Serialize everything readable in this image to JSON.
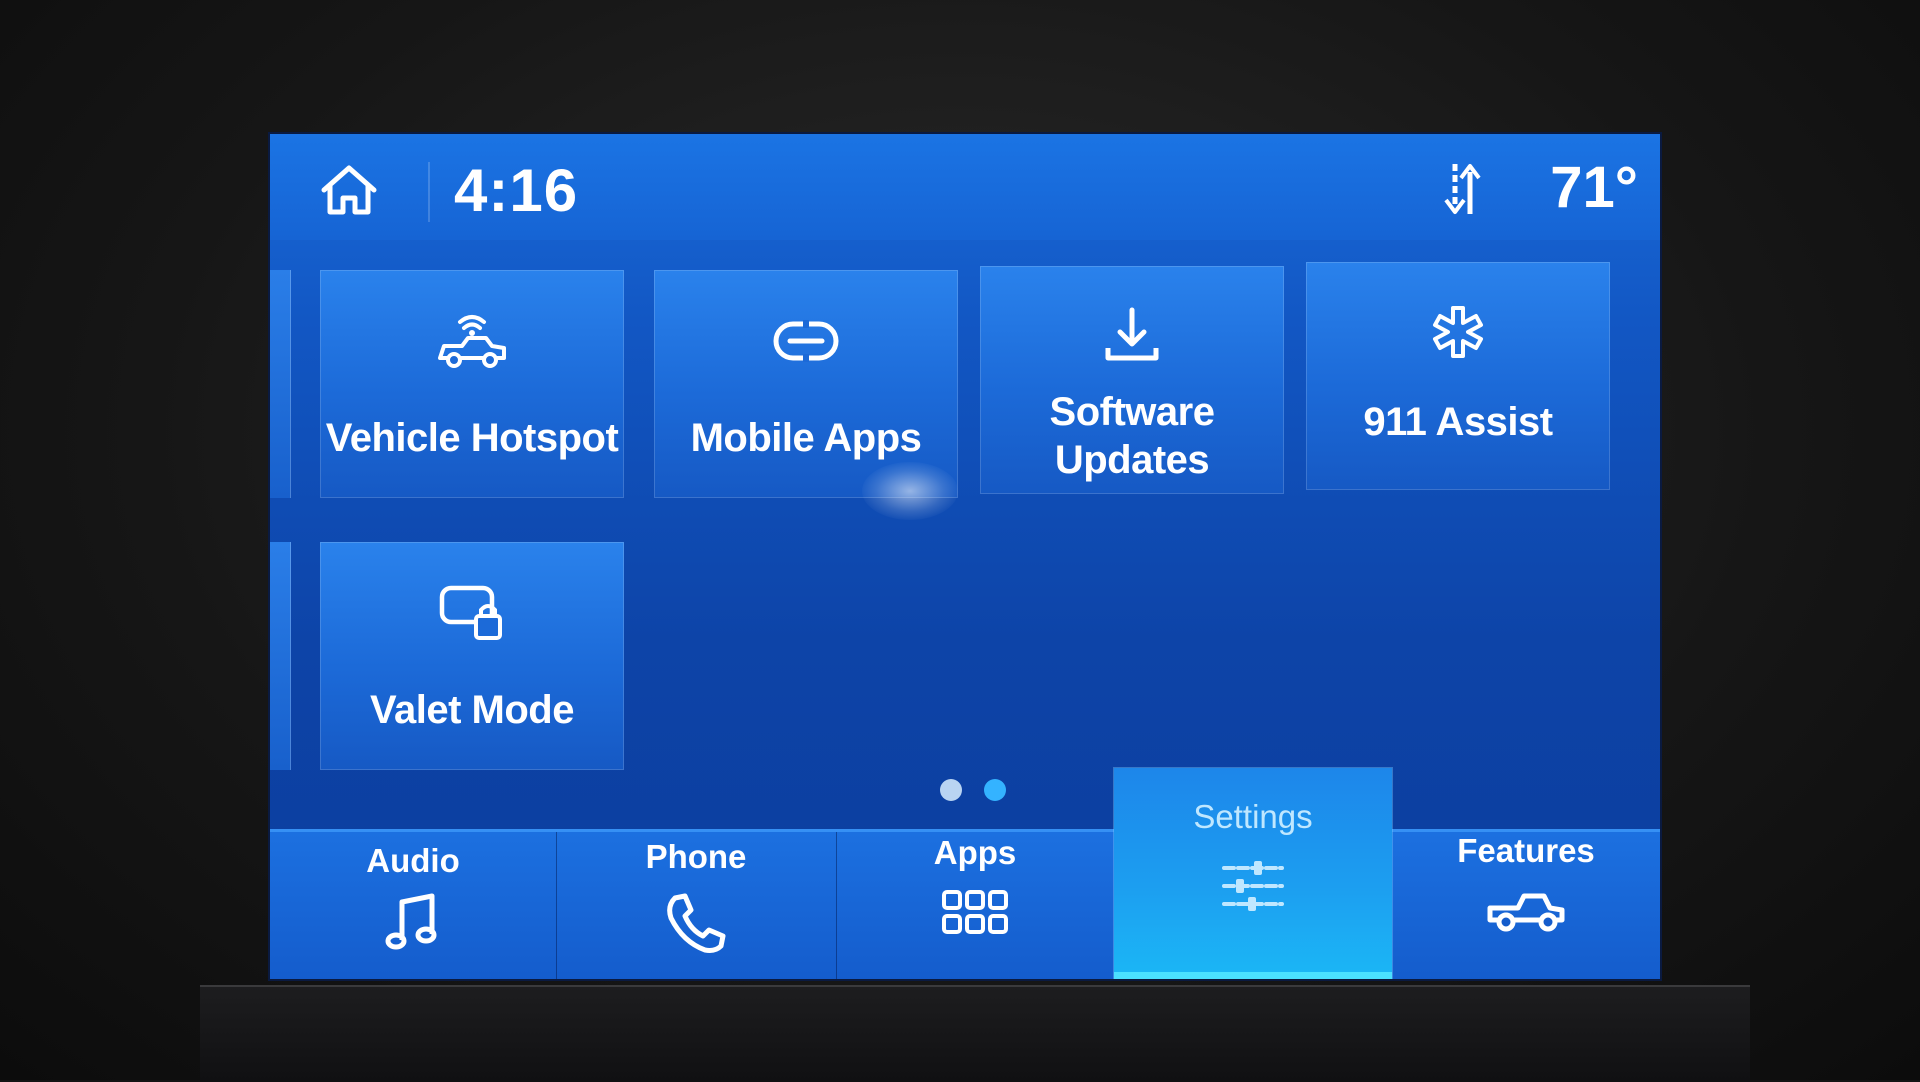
{
  "status_bar": {
    "time": "4:16",
    "temperature": "71°",
    "home_icon": "home-icon",
    "data_icon": "data-transfer-icon"
  },
  "tiles": [
    {
      "label": "Vehicle Hotspot",
      "icon": "vehicle-wifi-icon"
    },
    {
      "label": "Mobile Apps",
      "icon": "link-icon"
    },
    {
      "label": "Software\nUpdates",
      "icon": "download-icon"
    },
    {
      "label": "911 Assist",
      "icon": "emergency-star-icon"
    },
    {
      "label": "Valet Mode",
      "icon": "valet-lock-icon"
    }
  ],
  "pager": {
    "pages": 2,
    "current_page": 2,
    "inactive_color": "#b9d4f2",
    "active_color": "#34b3ff"
  },
  "nav": [
    {
      "label": "Audio",
      "icon": "music-note-icon",
      "active": false
    },
    {
      "label": "Phone",
      "icon": "phone-icon",
      "active": false
    },
    {
      "label": "Apps",
      "icon": "apps-grid-icon",
      "active": false
    },
    {
      "label": "Settings",
      "icon": "settings-sliders-icon",
      "active": true
    },
    {
      "label": "Features",
      "icon": "truck-icon",
      "active": false
    }
  ],
  "colors": {
    "screen_blue": "#1257c4",
    "tile_blue": "#2a82ec",
    "active_tab": "#1bb8f6",
    "active_underline": "#4be0ff"
  }
}
